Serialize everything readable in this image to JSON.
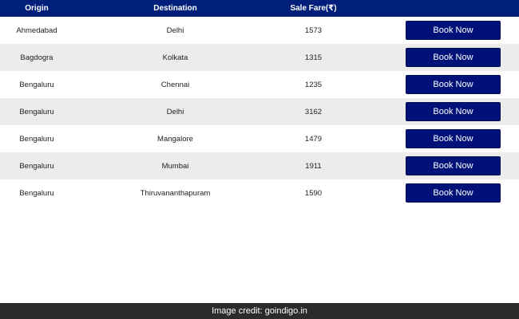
{
  "table": {
    "headers": {
      "origin": "Origin",
      "destination": "Destination",
      "sale_fare": "Sale Fare(₹)",
      "action": ""
    },
    "rows": [
      {
        "origin": "Ahmedabad",
        "destination": "Delhi",
        "fare": "1573",
        "button": "Book Now"
      },
      {
        "origin": "Bagdogra",
        "destination": "Kolkata",
        "fare": "1315",
        "button": "Book Now"
      },
      {
        "origin": "Bengaluru",
        "destination": "Chennai",
        "fare": "1235",
        "button": "Book Now"
      },
      {
        "origin": "Bengaluru",
        "destination": "Delhi",
        "fare": "3162",
        "button": "Book Now"
      },
      {
        "origin": "Bengaluru",
        "destination": "Mangalore",
        "fare": "1479",
        "button": "Book Now"
      },
      {
        "origin": "Bengaluru",
        "destination": "Mumbai",
        "fare": "1911",
        "button": "Book Now"
      },
      {
        "origin": "Bengaluru",
        "destination": "Thiruvananthapuram",
        "fare": "1590",
        "button": "Book Now"
      }
    ]
  },
  "credit": "Image credit: goindigo.in",
  "colors": {
    "header_bg": "#001f7a",
    "button_bg": "#00127a",
    "alt_row_bg": "#ececec",
    "credit_bg": "#2b2b2b"
  }
}
